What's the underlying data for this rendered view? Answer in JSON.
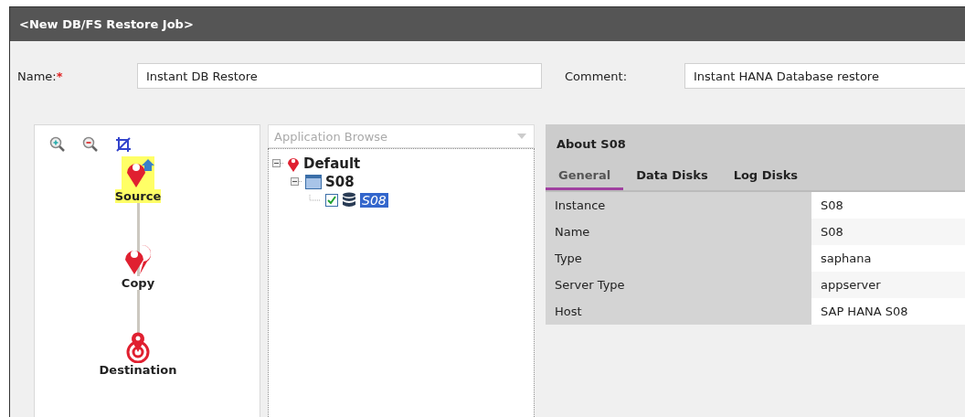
{
  "window": {
    "title": "<New DB/FS Restore Job>"
  },
  "form": {
    "name_label": "Name:",
    "required_mark": "*",
    "name_value": "Instant DB Restore",
    "comment_label": "Comment:",
    "comment_value": "Instant HANA Database restore"
  },
  "workflow": {
    "steps": [
      {
        "kind": "source",
        "label": "Source",
        "selected": true
      },
      {
        "kind": "copy",
        "label": "Copy",
        "selected": false
      },
      {
        "kind": "destination",
        "label": "Destination",
        "selected": false
      }
    ]
  },
  "browser": {
    "placeholder": "Application Browse",
    "tree": [
      {
        "kind": "location",
        "label": "Default",
        "expanded": true,
        "selected": false,
        "children": [
          {
            "kind": "instance",
            "label": "S08",
            "expanded": true,
            "selected": false,
            "children": [
              {
                "kind": "database",
                "label": "S08",
                "checked": true,
                "selected": true
              }
            ]
          }
        ]
      }
    ]
  },
  "details": {
    "title": "About S08",
    "tabs": [
      {
        "label": "General",
        "selected": true
      },
      {
        "label": "Data Disks",
        "selected": false
      },
      {
        "label": "Log Disks",
        "selected": false
      }
    ],
    "rows": [
      {
        "label": "Instance",
        "value": "S08"
      },
      {
        "label": "Name",
        "value": "S08"
      },
      {
        "label": "Type",
        "value": "saphana"
      },
      {
        "label": "Server Type",
        "value": "appserver"
      },
      {
        "label": "Host",
        "value": "SAP HANA S08"
      }
    ]
  }
}
